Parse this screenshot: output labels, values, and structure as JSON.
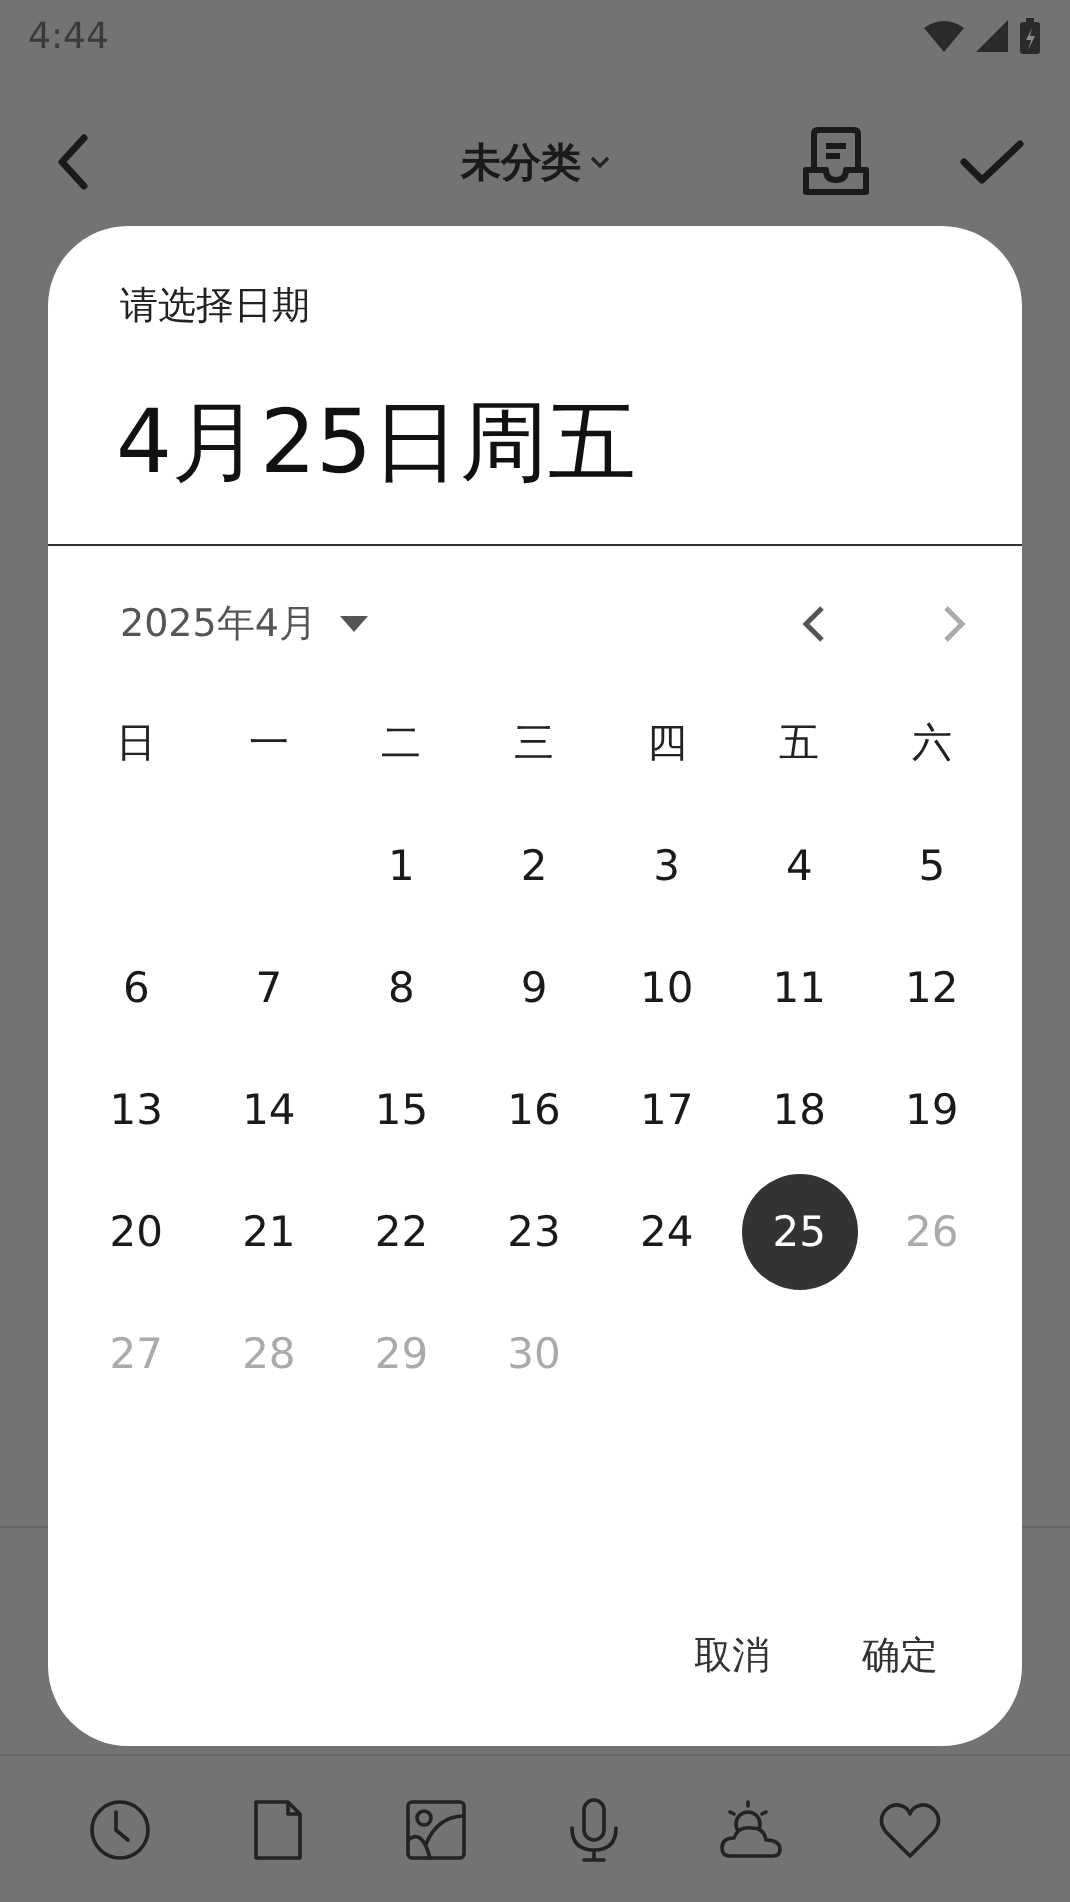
{
  "status_bar": {
    "time": "4:44"
  },
  "toolbar": {
    "title": "未分类"
  },
  "dialog": {
    "label": "请选择日期",
    "headline": "4月25日周五",
    "month": "2025年4月",
    "weekdays": [
      "日",
      "一",
      "二",
      "三",
      "四",
      "五",
      "六"
    ],
    "days": [
      {
        "kind": "blank"
      },
      {
        "kind": "blank"
      },
      {
        "kind": "day",
        "label": "1",
        "selected": false,
        "disabled": false
      },
      {
        "kind": "day",
        "label": "2",
        "selected": false,
        "disabled": false
      },
      {
        "kind": "day",
        "label": "3",
        "selected": false,
        "disabled": false
      },
      {
        "kind": "day",
        "label": "4",
        "selected": false,
        "disabled": false
      },
      {
        "kind": "day",
        "label": "5",
        "selected": false,
        "disabled": false
      },
      {
        "kind": "day",
        "label": "6",
        "selected": false,
        "disabled": false
      },
      {
        "kind": "day",
        "label": "7",
        "selected": false,
        "disabled": false
      },
      {
        "kind": "day",
        "label": "8",
        "selected": false,
        "disabled": false
      },
      {
        "kind": "day",
        "label": "9",
        "selected": false,
        "disabled": false
      },
      {
        "kind": "day",
        "label": "10",
        "selected": false,
        "disabled": false
      },
      {
        "kind": "day",
        "label": "11",
        "selected": false,
        "disabled": false
      },
      {
        "kind": "day",
        "label": "12",
        "selected": false,
        "disabled": false
      },
      {
        "kind": "day",
        "label": "13",
        "selected": false,
        "disabled": false
      },
      {
        "kind": "day",
        "label": "14",
        "selected": false,
        "disabled": false
      },
      {
        "kind": "day",
        "label": "15",
        "selected": false,
        "disabled": false
      },
      {
        "kind": "day",
        "label": "16",
        "selected": false,
        "disabled": false
      },
      {
        "kind": "day",
        "label": "17",
        "selected": false,
        "disabled": false
      },
      {
        "kind": "day",
        "label": "18",
        "selected": false,
        "disabled": false
      },
      {
        "kind": "day",
        "label": "19",
        "selected": false,
        "disabled": false
      },
      {
        "kind": "day",
        "label": "20",
        "selected": false,
        "disabled": false
      },
      {
        "kind": "day",
        "label": "21",
        "selected": false,
        "disabled": false
      },
      {
        "kind": "day",
        "label": "22",
        "selected": false,
        "disabled": false
      },
      {
        "kind": "day",
        "label": "23",
        "selected": false,
        "disabled": false
      },
      {
        "kind": "day",
        "label": "24",
        "selected": false,
        "disabled": false
      },
      {
        "kind": "day",
        "label": "25",
        "selected": true,
        "disabled": false
      },
      {
        "kind": "day",
        "label": "26",
        "selected": false,
        "disabled": true
      },
      {
        "kind": "day",
        "label": "27",
        "selected": false,
        "disabled": true
      },
      {
        "kind": "day",
        "label": "28",
        "selected": false,
        "disabled": true
      },
      {
        "kind": "day",
        "label": "29",
        "selected": false,
        "disabled": true
      },
      {
        "kind": "day",
        "label": "30",
        "selected": false,
        "disabled": true
      }
    ],
    "buttons": [
      "取消",
      "确定"
    ]
  }
}
